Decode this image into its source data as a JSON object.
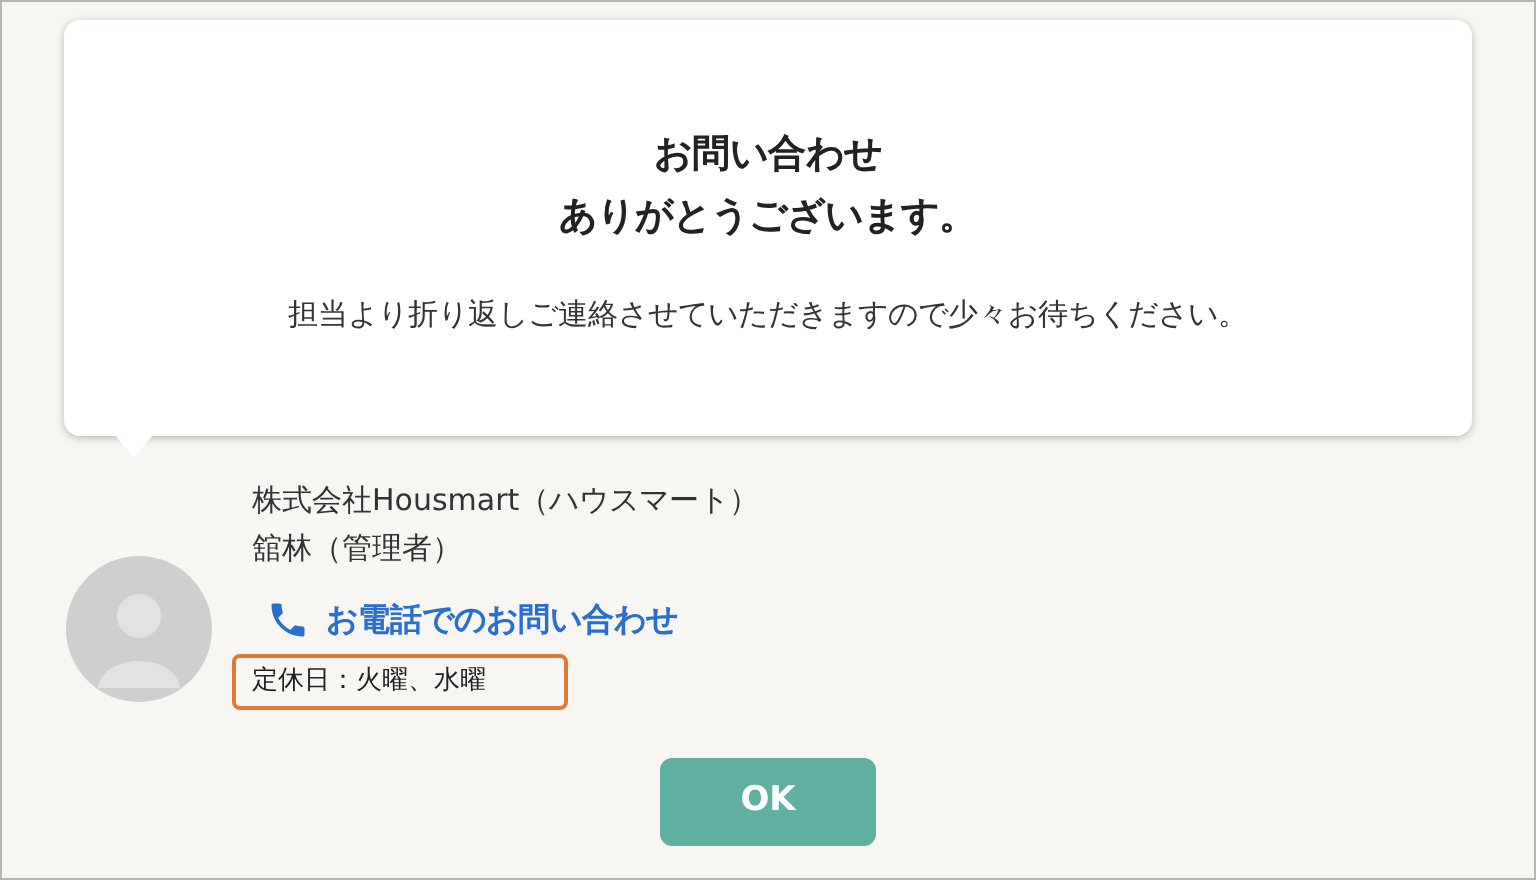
{
  "message": {
    "title_lines": [
      "お問い合わせ",
      "ありがとうございます。"
    ],
    "body": "担当より折り返しご連絡させていただきますので少々お待ちください。"
  },
  "contact": {
    "company": "株式会社Housmart（ハウスマート）",
    "person": "舘林（管理者）",
    "phone_link": "お電話でのお問い合わせ",
    "holidays": "定休日：火曜、水曜"
  },
  "buttons": [
    {
      "label": "OK"
    }
  ]
}
